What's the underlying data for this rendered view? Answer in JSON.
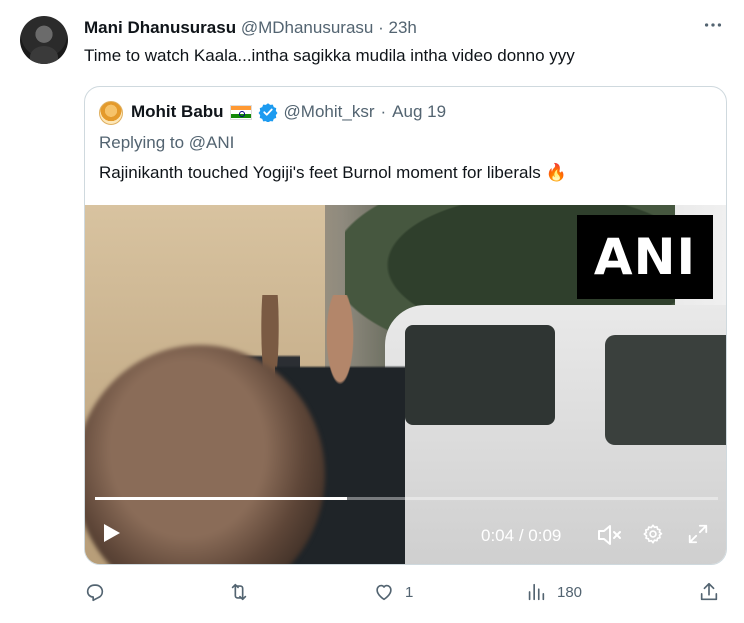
{
  "tweet": {
    "author_name": "Mani Dhanusurasu",
    "author_handle": "@MDhanusurasu",
    "separator": "·",
    "time": "23h",
    "text": "Time to watch Kaala...intha sagikka mudila intha video donno yyy",
    "more_icon": "more-horizontal-icon"
  },
  "quoted": {
    "author_name": "Mohit Babu",
    "author_handle": "@Mohit_ksr",
    "separator": "·",
    "date": "Aug 19",
    "replying_prefix": "Replying to",
    "replying_mention": "@ANI",
    "text": "Rajinikanth touched Yogiji's feet Burnol moment for liberals 🔥",
    "verified_color": "#1d9bf0",
    "video": {
      "watermark": "ANI",
      "current_time": "0:04",
      "time_separator": "/",
      "duration": "0:09",
      "progress_fraction": 0.405
    }
  },
  "actions": {
    "reply_count": "",
    "retweet_count": "",
    "like_count": "1",
    "views_count": "180"
  }
}
